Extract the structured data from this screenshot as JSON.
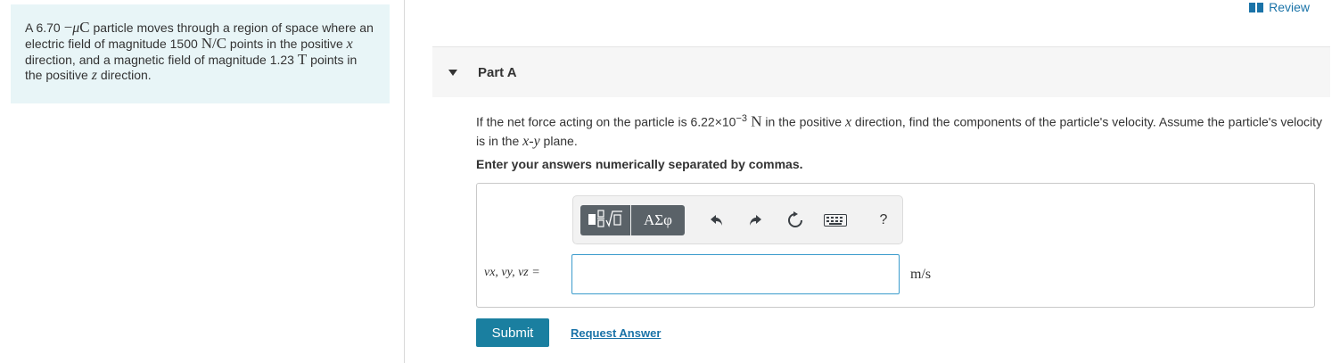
{
  "review": {
    "label": "Review"
  },
  "problem": {
    "p1": "A 6.70 ",
    "dash": "−",
    "mu": "μ",
    "unit_c": "C",
    "p2": " particle moves through a region of space where an electric field of magnitude 1500 ",
    "nc": "N/C",
    "p3": " points in the positive ",
    "x": "x",
    "p4": " direction, and a magnetic field of magnitude 1.23 ",
    "t": "T",
    "p5": " points in the positive ",
    "z": "z",
    "p6": " direction."
  },
  "part": {
    "title": "Part A"
  },
  "question": {
    "q1": "If the net force acting on the particle is 6.22×10",
    "exp": "−3",
    "q2": " N",
    "q3": " in the positive ",
    "x": "x",
    "q4": " direction, find the components of the particle's velocity. Assume the particle's velocity is in the ",
    "xy": "x-y",
    "q5": " plane."
  },
  "instructions": "Enter your answers numerically separated by commas.",
  "toolbar": {
    "greek_label": "ΑΣφ",
    "help_label": "?"
  },
  "answer": {
    "var_label": "vx, vy, vz =",
    "value": "",
    "unit": "m/s"
  },
  "actions": {
    "submit_label": "Submit",
    "request_label": "Request Answer"
  },
  "colors": {
    "accent": "#1a7fa0",
    "link": "#1a73a8",
    "problem_bg": "#e8f5f7",
    "toolbar_dark": "#5a6268"
  }
}
